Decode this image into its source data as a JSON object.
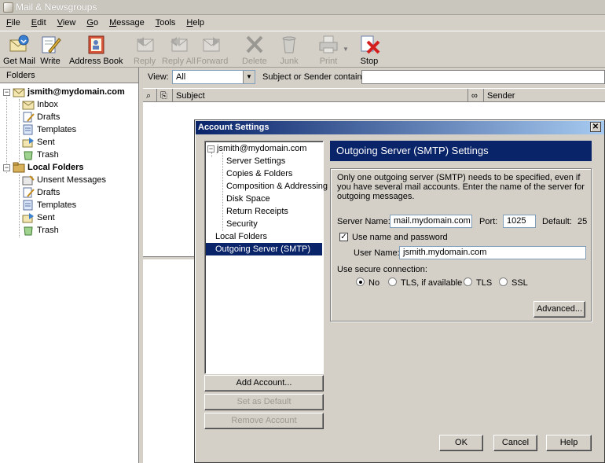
{
  "window": {
    "title": "Mail & Newsgroups"
  },
  "menu": [
    "File",
    "Edit",
    "View",
    "Go",
    "Message",
    "Tools",
    "Help"
  ],
  "menu_mnemonic": [
    "F",
    "E",
    "V",
    "G",
    "M",
    "T",
    "H"
  ],
  "toolbar": {
    "get_mail": "Get Mail",
    "write": "Write",
    "address_book": "Address Book",
    "reply": "Reply",
    "reply_all": "Reply All",
    "forward": "Forward",
    "delete": "Delete",
    "junk": "Junk",
    "print": "Print",
    "stop": "Stop"
  },
  "folders": {
    "header": "Folders",
    "account": "jsmith@mydomain.com",
    "account_items": [
      "Inbox",
      "Drafts",
      "Templates",
      "Sent",
      "Trash"
    ],
    "local": "Local Folders",
    "local_items": [
      "Unsent Messages",
      "Drafts",
      "Templates",
      "Sent",
      "Trash"
    ]
  },
  "filter": {
    "view_label": "View:",
    "view_value": "All",
    "search_label": "Subject or Sender contains:"
  },
  "columns": {
    "subject": "Subject",
    "sender": "Sender"
  },
  "dialog": {
    "title": "Account Settings",
    "tree": {
      "account": "jsmith@mydomain.com",
      "items": [
        "Server Settings",
        "Copies & Folders",
        "Composition & Addressing",
        "Disk Space",
        "Return Receipts",
        "Security"
      ],
      "local": "Local Folders",
      "smtp": "Outgoing Server (SMTP)"
    },
    "add_account": "Add Account...",
    "set_default": "Set as Default",
    "remove_account": "Remove Account",
    "panel_title": "Outgoing Server (SMTP) Settings",
    "description": "Only one outgoing server (SMTP) needs to be specified, even if you have several mail accounts. Enter the name of the server for outgoing messages.",
    "server_name_label": "Server Name:",
    "server_name": "mail.mydomain.com",
    "port_label": "Port:",
    "port": "1025",
    "default_label": "Default:",
    "default_value": "25",
    "use_auth_label": "Use name and password",
    "use_auth_checked": true,
    "user_name_label": "User Name:",
    "user_name": "jsmith.mydomain.com",
    "secure_label": "Use secure connection:",
    "secure_options": [
      "No",
      "TLS, if available",
      "TLS",
      "SSL"
    ],
    "secure_selected": "No",
    "advanced": "Advanced...",
    "ok": "OK",
    "cancel": "Cancel",
    "help": "Help"
  },
  "colors": {
    "selection": "#0a246a",
    "face": "#d4d0c8"
  }
}
